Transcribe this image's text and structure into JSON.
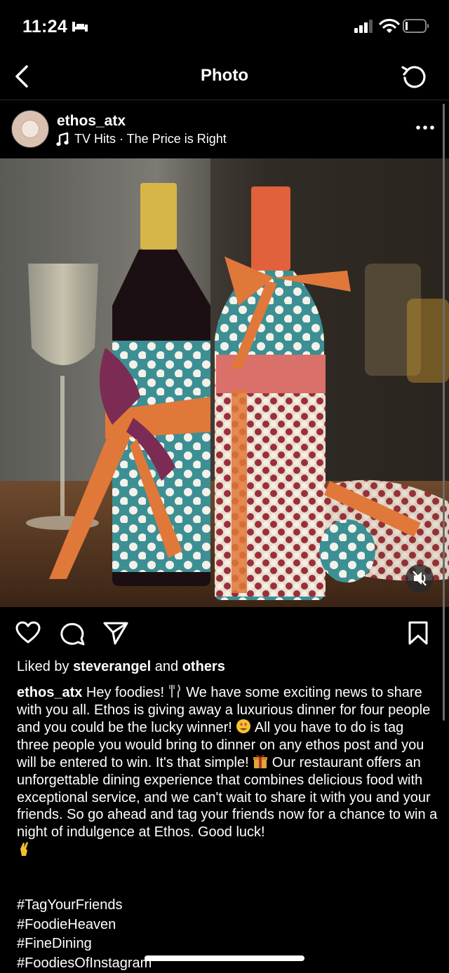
{
  "status_bar": {
    "time": "11:24"
  },
  "nav": {
    "title": "Photo"
  },
  "post": {
    "username": "ethos_atx",
    "audio": "TV Hits · The Price is Right",
    "image_alt": "Two wine bottles wrapped in polka-dot paper with orange and purple ribbons"
  },
  "likes": {
    "prefix": "Liked by ",
    "user": "steverangel",
    "middle": " and ",
    "others": "others"
  },
  "caption": {
    "username": "ethos_atx",
    "part1": " Hey foodies! ",
    "part2": " We have some exciting news to share with you all. Ethos is giving away a luxurious dinner for four people and you could be the lucky winner! ",
    "part3": " All you have to do is tag three people you would bring to dinner on any ethos post and you will be entered to win. It's that simple! ",
    "part4": " Our restaurant offers an unforgettable dining experience that combines delicious food with exceptional service, and we can't wait to share it with you and your friends. So go ahead and tag your friends now for a chance to win a night of indulgence at Ethos. Good luck!"
  },
  "hashtags": [
    "#TagYourFriends",
    "#FoodieHeaven",
    "#FineDining",
    "#FoodiesOfInstagram"
  ],
  "icons": {
    "sleep": "bed-icon",
    "signal": "cellular-signal-icon",
    "wifi": "wifi-icon",
    "battery": "battery-icon",
    "back": "chevron-left-icon",
    "refresh": "refresh-icon",
    "more": "more-dots-icon",
    "music": "music-note-icon",
    "mute": "speaker-muted-icon",
    "like": "heart-icon",
    "comment": "comment-bubble-icon",
    "share": "paper-plane-icon",
    "save": "bookmark-icon"
  }
}
